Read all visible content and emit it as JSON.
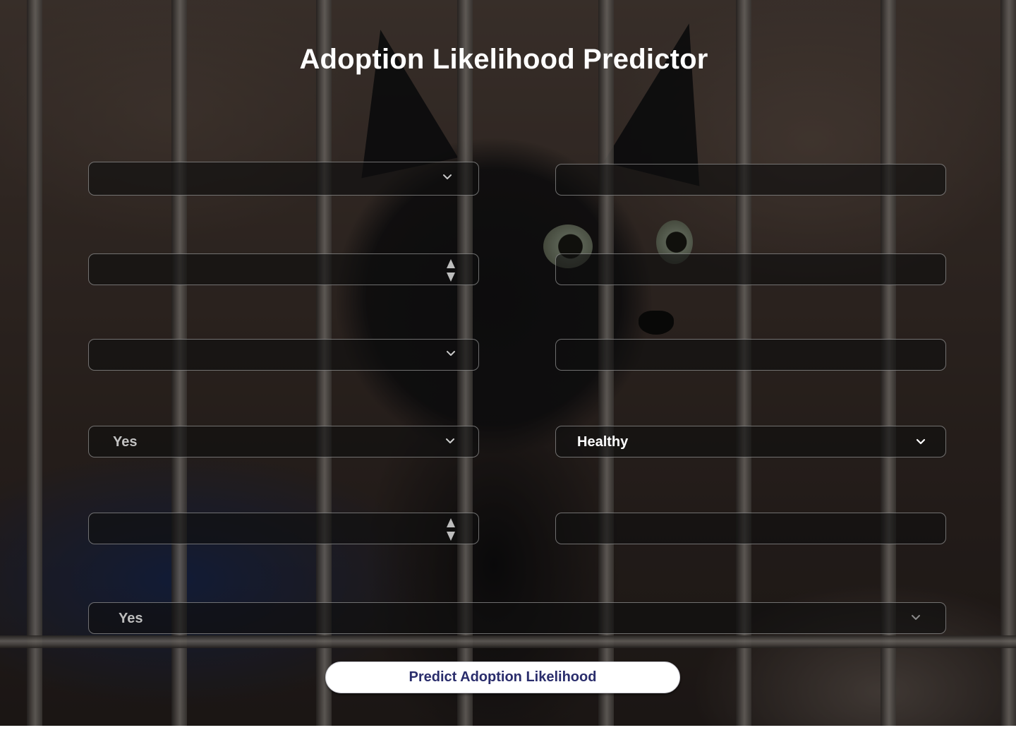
{
  "page": {
    "title": "Adoption Likelihood Predictor"
  },
  "form": {
    "row1_left_select": {
      "value": ""
    },
    "row1_right_input": {
      "value": ""
    },
    "row2_left_number": {
      "value": ""
    },
    "row2_right_input": {
      "value": ""
    },
    "row3_left_select": {
      "value": ""
    },
    "row3_right_input": {
      "value": ""
    },
    "row4_left_select": {
      "value": "Yes"
    },
    "row4_right_select": {
      "value": "Healthy"
    },
    "row5_left_number": {
      "value": ""
    },
    "row5_right_input": {
      "value": ""
    },
    "row6_full_select": {
      "value": "Yes"
    }
  },
  "actions": {
    "predict_label": "Predict Adoption Likelihood"
  },
  "icons": {
    "select": "chevron-down-icon",
    "number": "spinner-arrows-icon"
  },
  "colors": {
    "title_text": "#ffffff",
    "button_bg": "#ffffff",
    "button_text": "#2a2d6c",
    "field_bg": "#0e0e0e",
    "field_border": "#bebebe"
  }
}
